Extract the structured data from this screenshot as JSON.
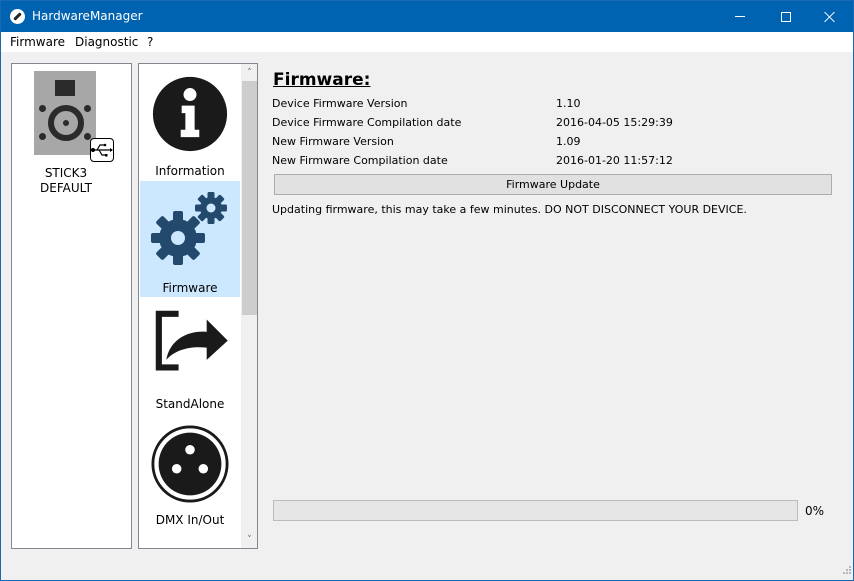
{
  "window": {
    "title": "HardwareManager",
    "controls": {
      "minimize": "minimize",
      "maximize": "maximize",
      "close": "close"
    }
  },
  "menubar": {
    "items": [
      {
        "label": "Firmware"
      },
      {
        "label": "Diagnostic"
      },
      {
        "label": "?"
      }
    ]
  },
  "device_panel": {
    "devices": [
      {
        "name_line1": "STICK3",
        "name_line2": "DEFAULT",
        "icon": "speaker-icon",
        "badge_icon": "usb-icon"
      }
    ]
  },
  "nav_panel": {
    "items": [
      {
        "label": "Information",
        "icon": "info-icon",
        "selected": false
      },
      {
        "label": "Firmware",
        "icon": "gears-icon",
        "selected": true
      },
      {
        "label": "StandAlone",
        "icon": "export-arrow-icon",
        "selected": false
      },
      {
        "label": "DMX In/Out",
        "icon": "xlr-connector-icon",
        "selected": false
      }
    ],
    "scroll_up": "˄",
    "scroll_down": "˅"
  },
  "firmware": {
    "title": "Firmware:",
    "rows": [
      {
        "label": "Device Firmware Version",
        "value": "1.10"
      },
      {
        "label": "Device Firmware Compilation date",
        "value": "2016-04-05 15:29:39"
      },
      {
        "label": "New Firmware Version",
        "value": "1.09"
      },
      {
        "label": "New Firmware Compilation date",
        "value": "2016-01-20 11:57:12"
      }
    ],
    "update_button": "Firmware Update",
    "warning": "Updating firmware, this may take a few minutes. DO NOT DISCONNECT YOUR DEVICE."
  },
  "progress": {
    "value_percent": 0,
    "text": "0%",
    "fill_color": "#06b025"
  },
  "colors": {
    "titlebar": "#0063b1",
    "selected_item": "#cce8ff",
    "gear_color": "#234a6d"
  }
}
